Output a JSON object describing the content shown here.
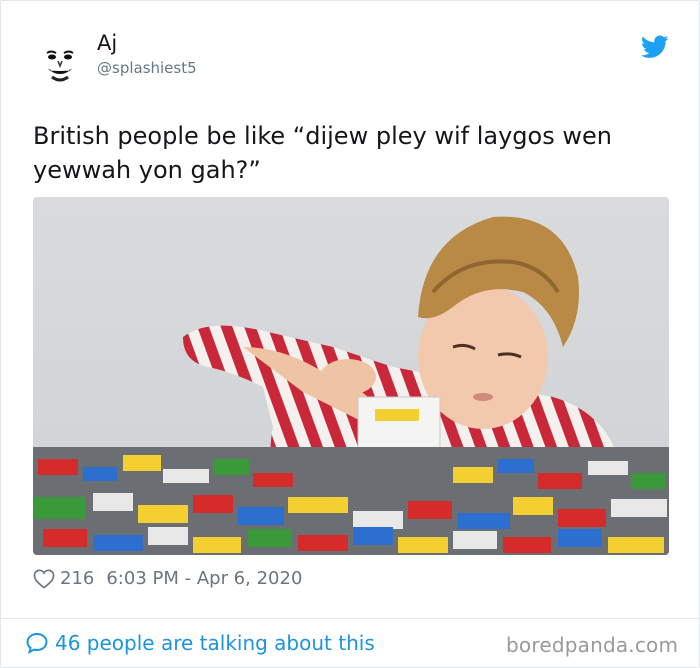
{
  "tweet": {
    "name": "Aj",
    "handle": "@splashiest5",
    "text": "British people be like “dijew pley wif laygos wen yewwah yon gah?”",
    "likes": "216",
    "timestamp": "6:03 PM - Apr 6, 2020",
    "talking": "46 people are talking about this"
  },
  "watermark": "boredpanda.com",
  "colors": {
    "twitter_blue": "#1da1f2",
    "link_blue": "#1b95e0",
    "muted": "#657786"
  },
  "icons": [
    "twitter-bird-icon",
    "heart-icon",
    "speech-bubble-icon"
  ]
}
